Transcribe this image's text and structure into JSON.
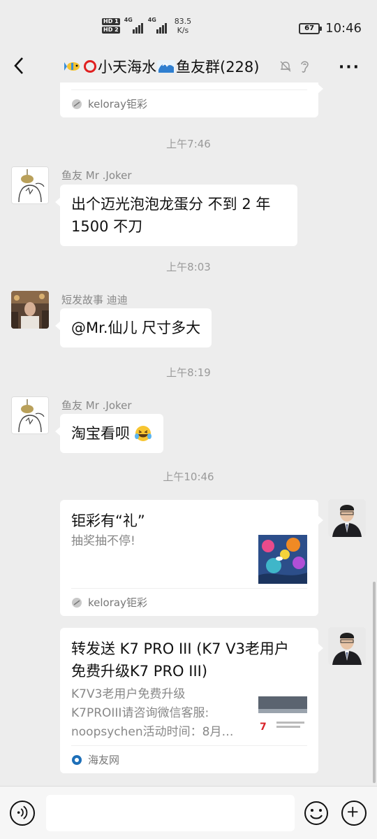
{
  "status_bar": {
    "sim1": "HD 1",
    "sim2": "HD 2",
    "net1": "4G",
    "net2": "4G",
    "speed_value": "83.5",
    "speed_unit": "K/s",
    "battery": "67",
    "time": "10:46"
  },
  "header": {
    "title_part1": "小天海水",
    "title_part2": "鱼友群(228)",
    "more_label": "···"
  },
  "messages": [
    {
      "type": "card_tail",
      "source": "keloray钜彩"
    },
    {
      "type": "time",
      "text": "上午7:46"
    },
    {
      "type": "text",
      "sender": "鱼友 Mr .Joker",
      "line1": "出个迈光泡泡龙蛋分 不到 2 年",
      "line2": "1500 不刀"
    },
    {
      "type": "time",
      "text": "上午8:03"
    },
    {
      "type": "text",
      "sender": "短发故事 迪迪",
      "line1": "@Mr.仙儿  尺寸多大"
    },
    {
      "type": "time",
      "text": "上午8:19"
    },
    {
      "type": "text",
      "sender": "鱼友 Mr .Joker",
      "line1": "淘宝看呗"
    },
    {
      "type": "time",
      "text": "上午10:46"
    },
    {
      "type": "card",
      "title": "钜彩有“礼”",
      "desc": "抽奖抽不停!",
      "source": "keloray钜彩"
    },
    {
      "type": "card",
      "title_line1": "转发送 K7 PRO III (K7 V3老用户",
      "title_line2": "免费升级K7 PRO III)",
      "desc_line1": "K7V3老用户免费升级",
      "desc_line2": "K7PROIII请咨询微信客服:",
      "desc_line3": "noopsychen活动时间：8月…",
      "source": "海友网"
    }
  ]
}
